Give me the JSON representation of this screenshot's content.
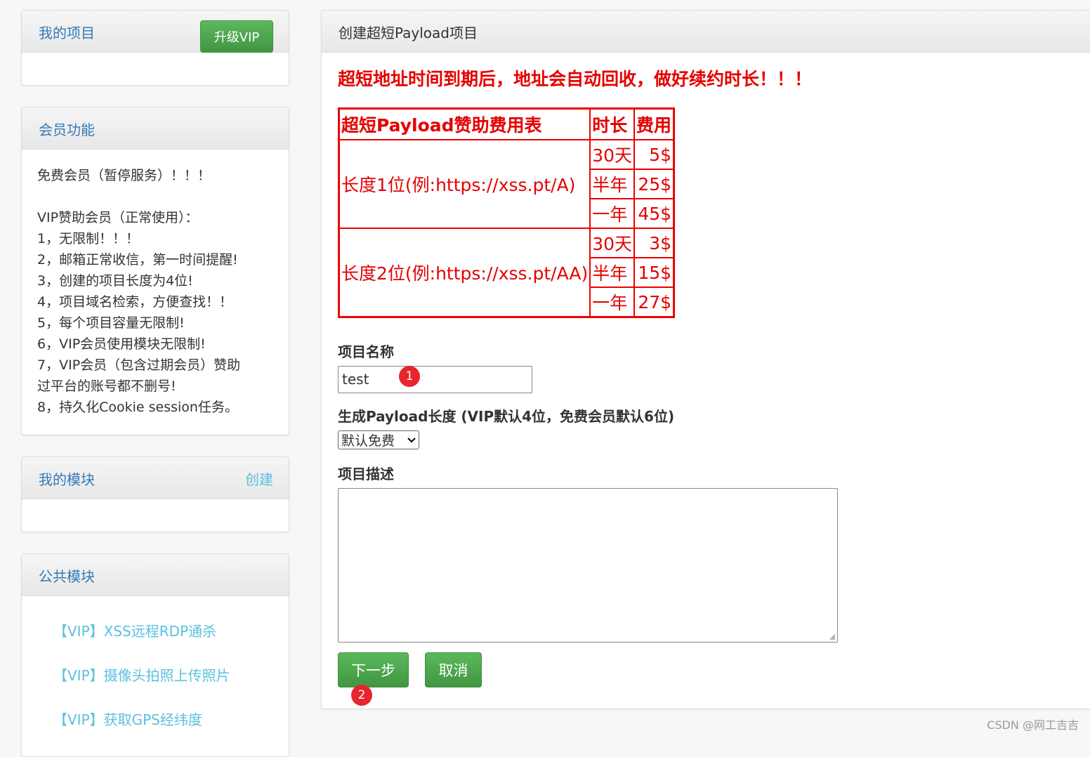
{
  "sidebar": {
    "my_projects": {
      "title": "我的项目",
      "vip_button": "升级VIP"
    },
    "membership": {
      "title": "会员功能",
      "lines": [
        "免费会员（暂停服务）！！！",
        "",
        "VIP赞助会员（正常使用）：",
        "1，无限制！！！",
        "2，邮箱正常收信，第一时间提醒!",
        "3，创建的项目长度为4位!",
        "4，项目域名检索，方便查找！！",
        "5，每个项目容量无限制!",
        "6，VIP会员使用模块无限制!",
        "7，VIP会员（包含过期会员）赞助",
        "过平台的账号都不删号!",
        "8，持久化Cookie session任务。"
      ]
    },
    "my_modules": {
      "title": "我的模块",
      "create_link": "创建"
    },
    "public_modules": {
      "title": "公共模块",
      "items": [
        "【VIP】XSS远程RDP通杀",
        "【VIP】摄像头拍照上传照片",
        "【VIP】获取GPS经纬度"
      ]
    }
  },
  "main": {
    "title": "创建超短Payload项目",
    "warning": "超短地址时间到期后，地址会自动回收，做好续约时长！！！",
    "fee_table": {
      "headers": [
        "超短Payload赞助费用表",
        "时长",
        "费用"
      ],
      "groups": [
        {
          "label": "长度1位(例:https://xss.pt/A)",
          "rows": [
            [
              "30天",
              "5$"
            ],
            [
              "半年",
              "25$"
            ],
            [
              "一年",
              "45$"
            ]
          ]
        },
        {
          "label": "长度2位(例:https://xss.pt/AA)",
          "rows": [
            [
              "30天",
              "3$"
            ],
            [
              "半年",
              "15$"
            ],
            [
              "一年",
              "27$"
            ]
          ]
        }
      ]
    },
    "name_label": "项目名称",
    "name_value": "test",
    "length_label": "生成Payload长度 (VIP默认4位，免费会员默认6位)",
    "length_select": "默认免费",
    "desc_label": "项目描述",
    "desc_value": "",
    "next_button": "下一步",
    "cancel_button": "取消"
  },
  "annotations": {
    "badge1": "1",
    "badge2": "2"
  },
  "watermark": "CSDN @网工吉吉",
  "colors": {
    "accent_red": "#e60000",
    "button_green": "#4cae4c",
    "link_blue": "#337ab7",
    "link_cyan": "#5bc0de",
    "badge_red": "#e8242c"
  }
}
